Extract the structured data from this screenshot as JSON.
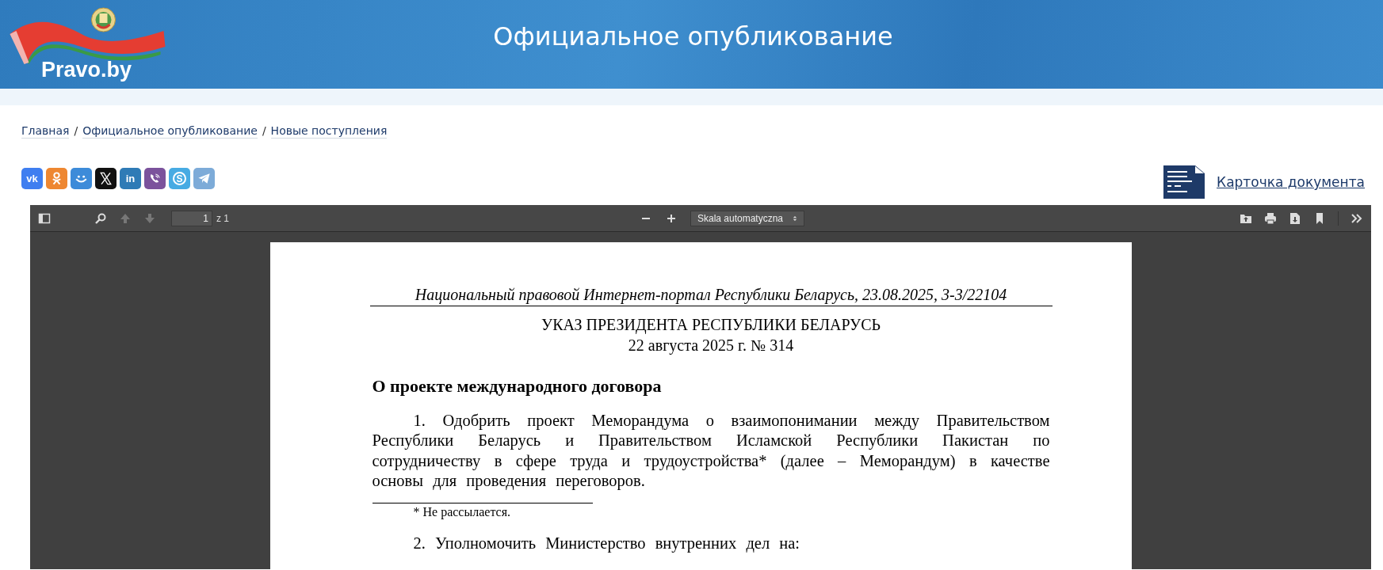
{
  "header": {
    "logo_text": "Pravo.by",
    "title": "Официальное опубликование"
  },
  "breadcrumbs": [
    "Главная",
    "Официальное опубликование",
    "Новые поступления"
  ],
  "breadcrumb_separator": "/",
  "share_buttons": [
    {
      "kind": "vk",
      "label": "vk"
    },
    {
      "kind": "ok"
    },
    {
      "kind": "smile"
    },
    {
      "kind": "x"
    },
    {
      "kind": "linkedin",
      "label": "in"
    },
    {
      "kind": "viber"
    },
    {
      "kind": "skype",
      "label": "S"
    },
    {
      "kind": "telegram"
    }
  ],
  "document_card_link": "Карточка документа",
  "pdf_viewer": {
    "toolbar": {
      "page_value": "1",
      "page_total": "z 1",
      "zoom_scale": "Skala automatyczna"
    },
    "page": {
      "source_line": "Национальный правовой Интернет-портал Республики Беларусь, 23.08.2025, 3-3/22104",
      "title_lines": [
        "УКАЗ ПРЕЗИДЕНТА РЕСПУБЛИКИ БЕЛАРУСЬ",
        "22 августа 2025 г. № 314"
      ],
      "heading": "О проекте международного договора",
      "blocks": [
        {
          "kind": "paragraph",
          "text": "1. Одобрить проект Меморандума о взаимопонимании между Правительством Республики Беларусь и Правительством Исламской Республики Пакистан по сотрудничеству в сфере труда и трудоустройства* (далее – Меморандум) в качестве основы для проведения переговоров."
        },
        {
          "kind": "footnote",
          "text": "* Не рассылается."
        },
        {
          "kind": "paragraph",
          "text": "2. Уполномочить Министерство внутренних дел на:"
        }
      ]
    }
  }
}
